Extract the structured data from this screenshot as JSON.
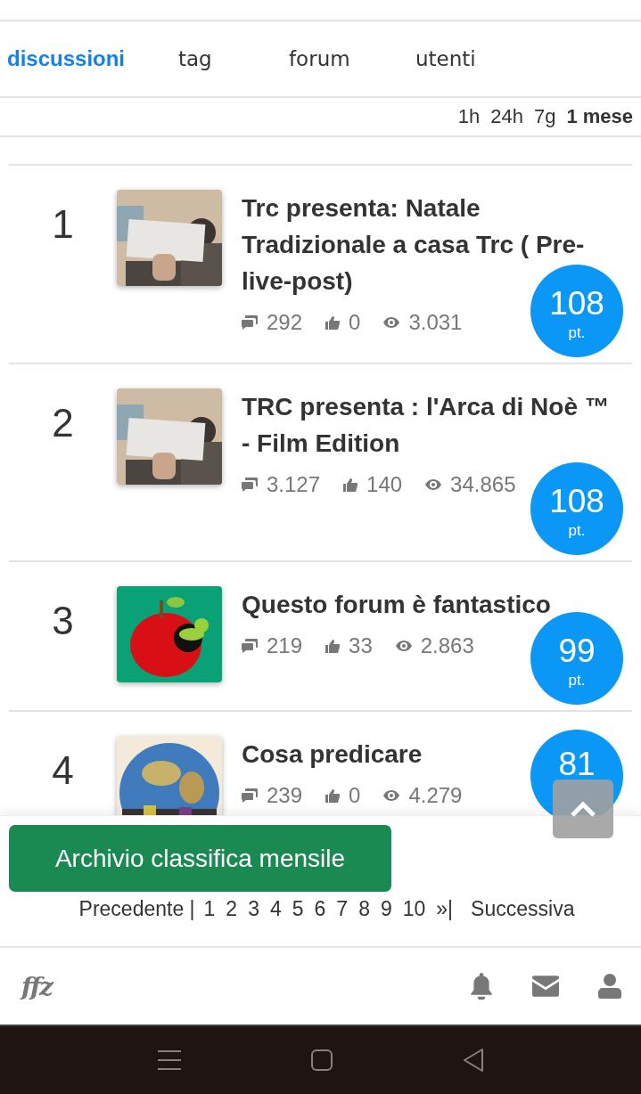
{
  "tabs": [
    {
      "label": "discussioni",
      "selected": true
    },
    {
      "label": "tag",
      "selected": false
    },
    {
      "label": "forum",
      "selected": false
    },
    {
      "label": "utenti",
      "selected": false
    }
  ],
  "periods": [
    {
      "label": "1h",
      "selected": false
    },
    {
      "label": "24h",
      "selected": false
    },
    {
      "label": "7g",
      "selected": false
    },
    {
      "label": "1 mese",
      "selected": true
    }
  ],
  "topics": [
    {
      "rank": "1",
      "title": "Trc presenta: Natale Tradizionale a casa Trc ( Pre-live-post)",
      "comments": "292",
      "likes": "0",
      "views": "3.031",
      "score": "108",
      "unit": "pt."
    },
    {
      "rank": "2",
      "title": "TRC presenta : l'Arca di Noè ™ - Film Edition",
      "comments": "3.127",
      "likes": "140",
      "views": "34.865",
      "score": "108",
      "unit": "pt."
    },
    {
      "rank": "3",
      "title": "Questo forum è fantastico",
      "comments": "219",
      "likes": "33",
      "views": "2.863",
      "score": "99",
      "unit": "pt."
    },
    {
      "rank": "4",
      "title": "Cosa predicare",
      "comments": "239",
      "likes": "0",
      "views": "4.279",
      "score": "81"
    }
  ],
  "archive_button": "Archivio classifica mensile",
  "pagination": {
    "previous": "Precedente |",
    "pages": [
      "1",
      "2",
      "3",
      "4",
      "5",
      "6",
      "7",
      "8",
      "9",
      "10"
    ],
    "last": "»|",
    "next": "Successiva"
  },
  "footer": {
    "logo": "ffz"
  }
}
